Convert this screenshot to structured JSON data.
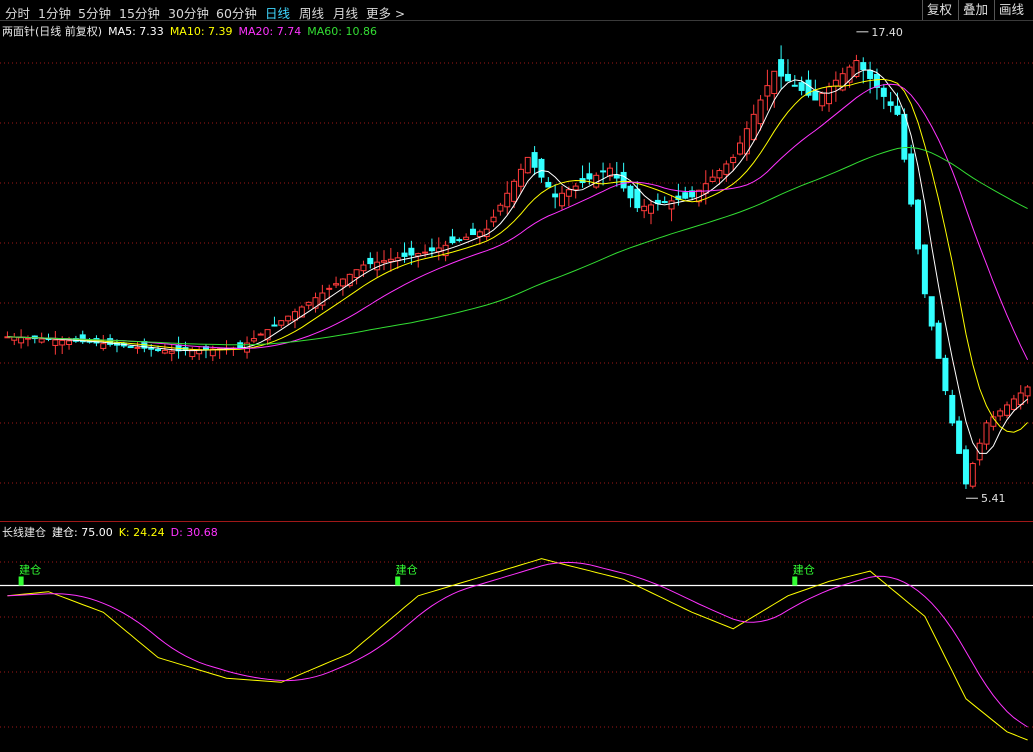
{
  "toolbar": {
    "periods": [
      "分时",
      "1分钟",
      "5分钟",
      "15分钟",
      "30分钟",
      "60分钟",
      "日线",
      "周线",
      "月线"
    ],
    "active_period": "日线",
    "more": "更多",
    "right_buttons": [
      "复权",
      "叠加",
      "画线"
    ]
  },
  "main": {
    "title": "两面针(日线 前复权)",
    "ma": [
      {
        "label": "MA5: 7.33",
        "color": "#ffffff"
      },
      {
        "label": "MA10: 7.39",
        "color": "#ffff00"
      },
      {
        "label": "MA20: 7.74",
        "color": "#ff33ff"
      },
      {
        "label": "MA60: 10.86",
        "color": "#33dd33"
      }
    ],
    "high_label": "17.40",
    "low_label": "5.41"
  },
  "indicator": {
    "name": "长线建仓",
    "values": [
      {
        "label": "建仓: 75.00",
        "color": "#ffffff"
      },
      {
        "label": "K: 24.24",
        "color": "#ffff00"
      },
      {
        "label": "D: 30.68",
        "color": "#ff33ff"
      }
    ],
    "signal_label": "建仓",
    "signal_color": "#33ff33"
  },
  "colors": {
    "up": "#ff3b3b",
    "down": "#33ffff",
    "grid": "#a01818",
    "ma5": "#ffffff",
    "ma10": "#ffff00",
    "ma20": "#ff33ff",
    "ma60": "#33dd33"
  }
}
